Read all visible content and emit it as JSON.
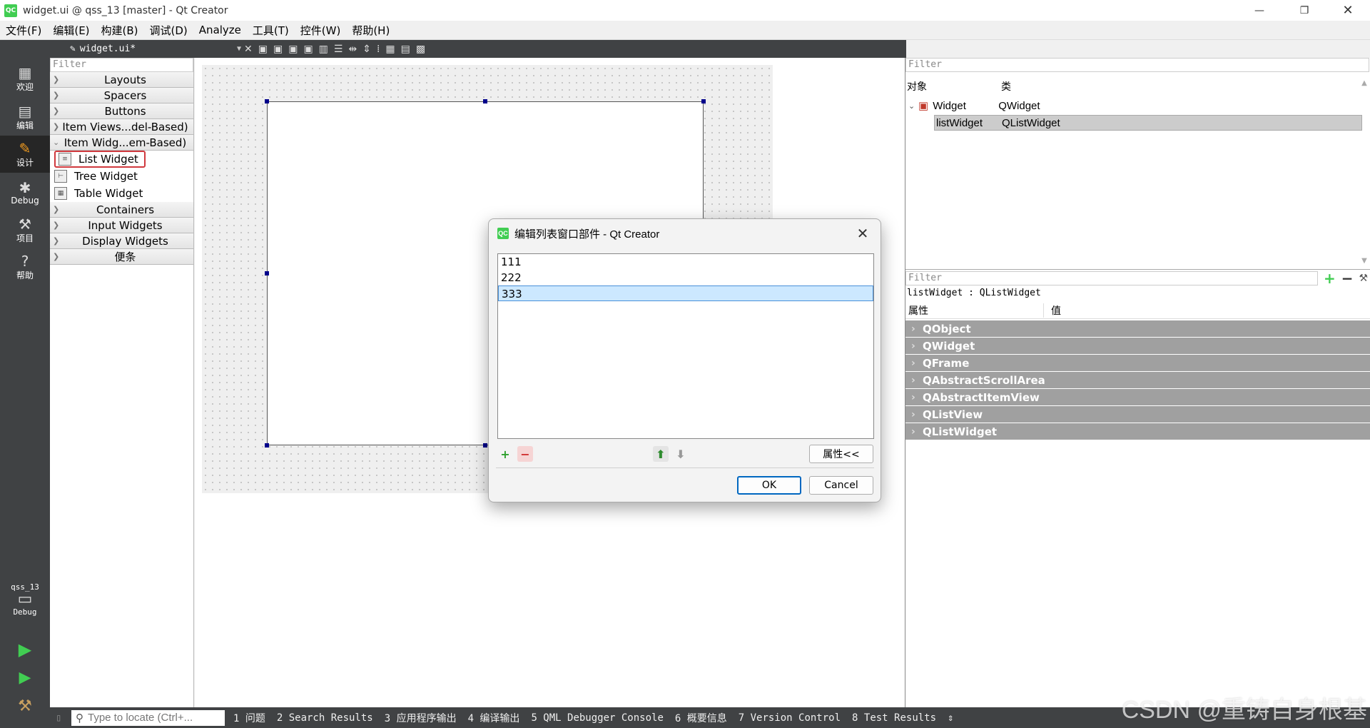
{
  "window": {
    "title": "widget.ui @ qss_13 [master] - Qt Creator",
    "app_icon": "QC"
  },
  "menu": [
    "文件(F)",
    "编辑(E)",
    "构建(B)",
    "调试(D)",
    "Analyze",
    "工具(T)",
    "控件(W)",
    "帮助(H)"
  ],
  "modes": [
    {
      "label": "欢迎",
      "icon": "grid-icon"
    },
    {
      "label": "编辑",
      "icon": "document-icon"
    },
    {
      "label": "设计",
      "icon": "pencil-icon"
    },
    {
      "label": "Debug",
      "icon": "bug-icon"
    },
    {
      "label": "项目",
      "icon": "wrench-icon"
    },
    {
      "label": "帮助",
      "icon": "help-icon"
    }
  ],
  "kit": {
    "project": "qss_13",
    "build": "Debug"
  },
  "doc_tab": {
    "name": "widget.ui*"
  },
  "widgetbox": {
    "filter_placeholder": "Filter",
    "categories_top": [
      "Layouts",
      "Spacers",
      "Buttons",
      "Item Views...del-Based)",
      "Item Widg...em-Based)"
    ],
    "items": [
      "List Widget",
      "Tree Widget",
      "Table Widget"
    ],
    "categories_bottom": [
      "Containers",
      "Input Widgets",
      "Display Widgets",
      "便条"
    ]
  },
  "object_inspector": {
    "filter_placeholder": "Filter",
    "col_object": "对象",
    "col_class": "类",
    "rows": [
      {
        "name": "Widget",
        "class": "QWidget"
      },
      {
        "name": "listWidget",
        "class": "QListWidget"
      }
    ]
  },
  "property_editor": {
    "filter_placeholder": "Filter",
    "current": "listWidget : QListWidget",
    "col_property": "属性",
    "col_value": "值",
    "groups": [
      "QObject",
      "QWidget",
      "QFrame",
      "QAbstractScrollArea",
      "QAbstractItemView",
      "QListView",
      "QListWidget"
    ]
  },
  "dialog": {
    "title": "编辑列表窗口部件 - Qt Creator",
    "items": [
      "111",
      "222",
      "333"
    ],
    "selected_index": 2,
    "properties_button": "属性<<",
    "ok": "OK",
    "cancel": "Cancel"
  },
  "statusbar": {
    "locate_placeholder": "Type to locate (Ctrl+...",
    "panes": [
      "1 问题",
      "2 Search Results",
      "3 应用程序输出",
      "4 编译输出",
      "5 QML Debugger Console",
      "6 概要信息",
      "7 Version Control",
      "8 Test Results"
    ]
  },
  "watermark": "CSDN @重铸自身根基",
  "colors": {
    "accent": "#41cd52",
    "sidebar": "#404244",
    "selection": "#cce8ff",
    "highlight_red": "#d0393e"
  }
}
